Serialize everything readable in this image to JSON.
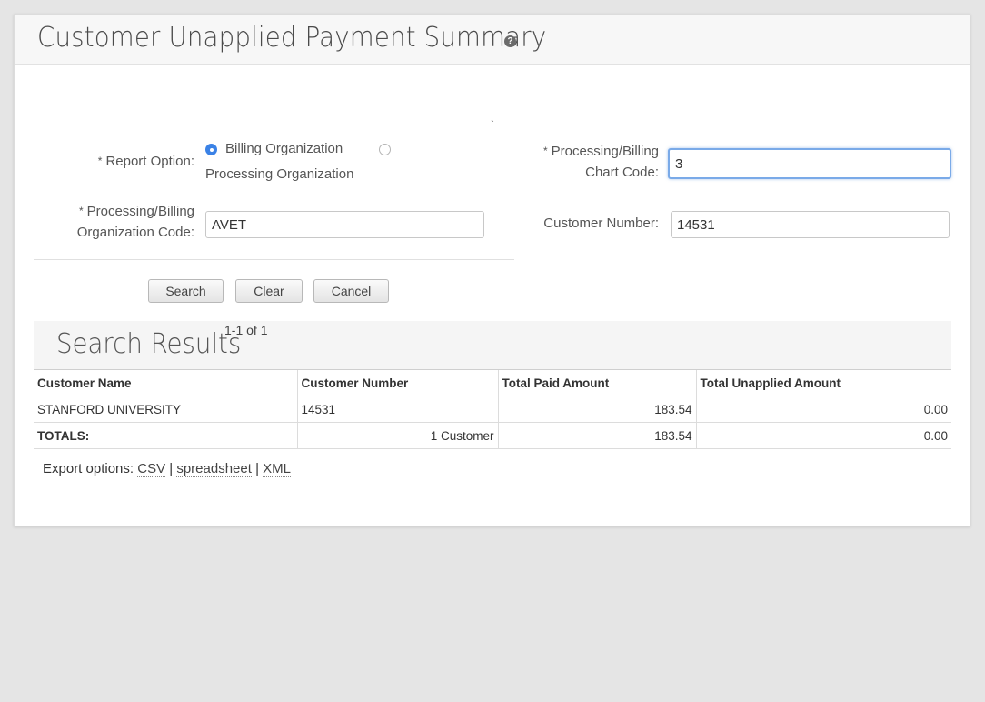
{
  "header": {
    "title": "Customer Unapplied Payment Summary",
    "help_icon": "?"
  },
  "form": {
    "report_option_label": "Report Option:",
    "report_options": [
      {
        "label": "Billing Organization",
        "selected": true
      },
      {
        "label": "Processing Organization",
        "selected": false
      }
    ],
    "org_code_label_line1": "Processing/Billing",
    "org_code_label_line2": "Organization Code:",
    "org_code_value": "AVET",
    "chart_code_label_line1": "Processing/Billing",
    "chart_code_label_line2": "Chart Code:",
    "chart_code_value": "3",
    "customer_number_label": "Customer Number:",
    "customer_number_value": "14531",
    "required_mark": "*",
    "stray_mark": "`"
  },
  "buttons": {
    "search": "Search",
    "clear": "Clear",
    "cancel": "Cancel"
  },
  "results": {
    "title": "Search Results",
    "pager": "1-1 of 1",
    "columns": [
      "Customer Name",
      "Customer Number",
      "Total Paid Amount",
      "Total Unapplied Amount"
    ],
    "rows": [
      {
        "customer_name": "STANFORD UNIVERSITY",
        "customer_number": "14531",
        "total_paid": "183.54",
        "total_unapplied": "0.00"
      }
    ],
    "totals": {
      "label": "TOTALS:",
      "customers": "1 Customer",
      "total_paid": "183.54",
      "total_unapplied": "0.00"
    }
  },
  "export": {
    "label": "Export options:",
    "csv": "CSV",
    "spreadsheet": "spreadsheet",
    "xml": "XML",
    "separator": "|"
  },
  "colors": {
    "accent": "#3b82e6",
    "focus_border": "#7aaae8",
    "background": "#e5e5e5"
  }
}
